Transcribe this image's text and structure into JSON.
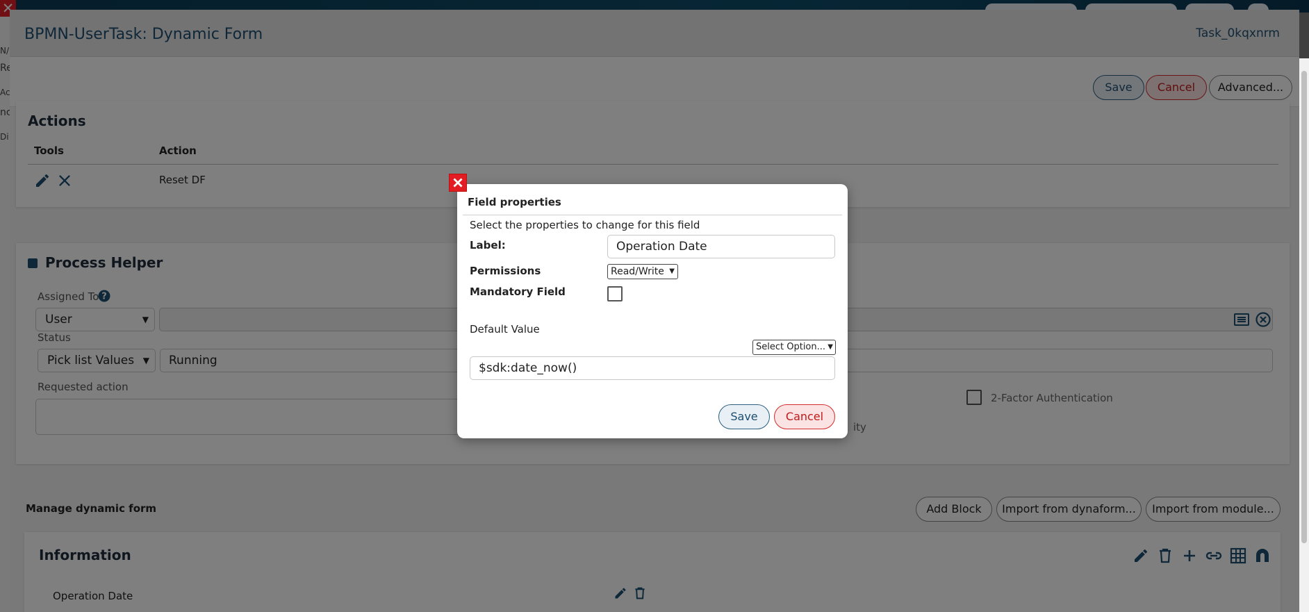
{
  "dialog": {
    "title": "BPMN-UserTask: Dynamic Form",
    "task_id": "Task_0kqxnrm",
    "toolbar": {
      "save": "Save",
      "cancel": "Cancel",
      "advanced": "Advanced..."
    }
  },
  "background": {
    "left_strip_texts": [
      "N/",
      "Re",
      "Ac",
      "nc",
      "Di"
    ]
  },
  "actions": {
    "title": "Actions",
    "columns": [
      "Tools",
      "Action"
    ],
    "rows": [
      {
        "action": "Reset DF"
      }
    ]
  },
  "process_helper": {
    "title": "Process Helper",
    "assigned_to_label": "Assigned To",
    "assigned_to_type": "User",
    "status_label": "Status",
    "status_type": "Pick list Values",
    "status_value": "Running",
    "requested_action_label": "Requested action",
    "two_factor_label": "2-Factor Authentication",
    "partial_text": "ity"
  },
  "manage_form": {
    "title": "Manage dynamic form",
    "add_block": "Add Block",
    "import_dynaform": "Import from dynaform...",
    "import_module": "Import from module...",
    "block_title": "Information",
    "field_label": "Operation Date"
  },
  "field_properties": {
    "title": "Field properties",
    "subtitle": "Select the properties to change for this field",
    "label_caption": "Label:",
    "label_value": "Operation Date",
    "permissions_caption": "Permissions",
    "permissions_value": "Read/Write",
    "mandatory_caption": "Mandatory Field",
    "default_value_caption": "Default Value",
    "select_option": "Select Option...",
    "default_value": "$sdk:date_now()",
    "save": "Save",
    "cancel": "Cancel"
  },
  "colors": {
    "accent": "#1d4e72",
    "danger": "#d22b2b"
  }
}
